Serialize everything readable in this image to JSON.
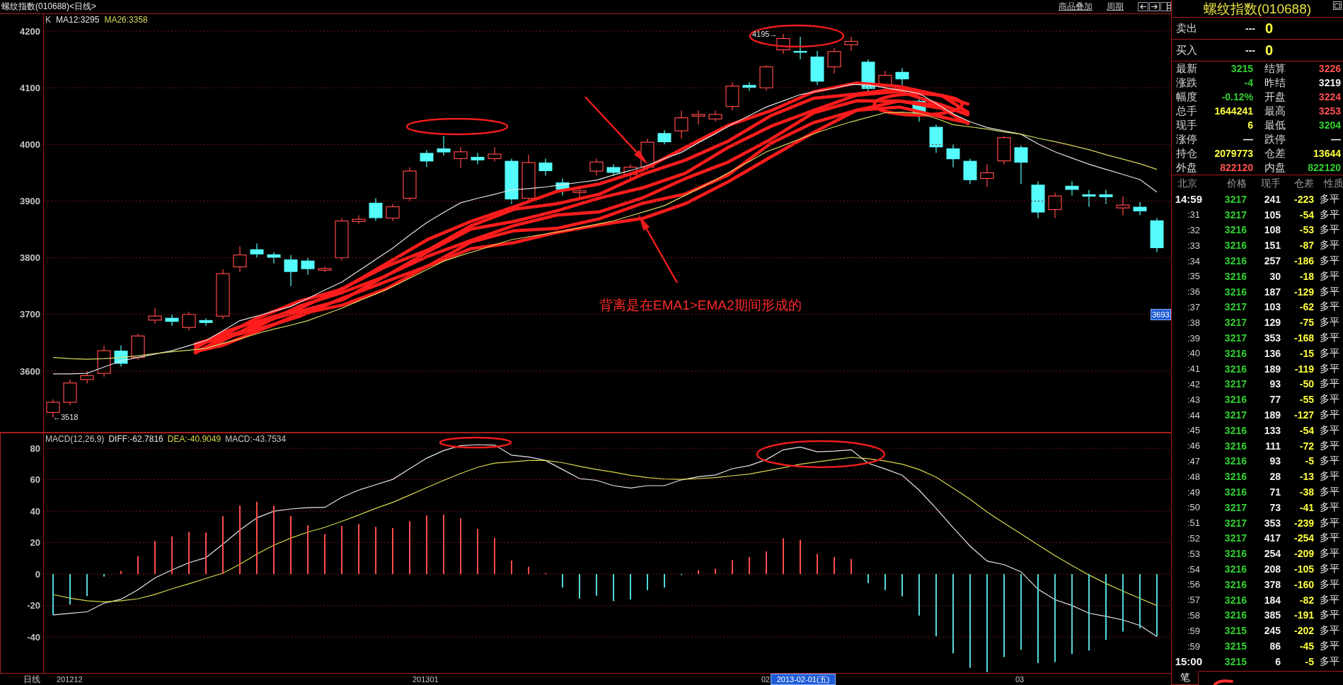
{
  "window": {
    "title": "螺纹指数(010688)<日线>"
  },
  "toolbar": {
    "links": [
      "商品叠加",
      "周期"
    ]
  },
  "price_panel": {
    "chart_data": {
      "type": "line",
      "title": "K",
      "ylim": [
        3492,
        4230
      ],
      "yticks": [
        4200,
        4100,
        4000,
        3900,
        3800,
        3700,
        3600
      ],
      "grid": true,
      "series": [
        {
          "name": "MA12:3295",
          "color": "#e2e2e2",
          "values": [
            3595,
            3595,
            3596,
            3607,
            3618,
            3624,
            3630,
            3636,
            3645,
            3654,
            3671,
            3689,
            3697,
            3706,
            3714,
            3728,
            3743,
            3757,
            3777,
            3797,
            3817,
            3840,
            3862,
            3880,
            3897,
            3905,
            3912,
            3920,
            3922,
            3925,
            3929,
            3933,
            3937,
            3946,
            3954,
            3963,
            3975,
            3986,
            4003,
            4019,
            4036,
            4051,
            4066,
            4077,
            4088,
            4094,
            4099,
            4106,
            4105,
            4100,
            4095,
            4090,
            4072,
            4054,
            4040,
            4030,
            4024,
            4018,
            4001,
            3987,
            3976,
            3965,
            3956,
            3947,
            3938,
            3916
          ]
        },
        {
          "name": "MA26:3358",
          "color": "#d8d860",
          "values": [
            3624,
            3622,
            3621,
            3622,
            3624,
            3627,
            3631,
            3634,
            3637,
            3640,
            3649,
            3657,
            3666,
            3674,
            3681,
            3689,
            3700,
            3711,
            3724,
            3736,
            3749,
            3764,
            3779,
            3794,
            3804,
            3813,
            3823,
            3832,
            3837,
            3842,
            3847,
            3853,
            3859,
            3865,
            3874,
            3883,
            3892,
            3907,
            3922,
            3937,
            3954,
            3970,
            3987,
            3998,
            4010,
            4021,
            4031,
            4040,
            4048,
            4056,
            4057,
            4055,
            4046,
            4035,
            4031,
            4027,
            4022,
            4018,
            4011,
            4005,
            3998,
            3991,
            3982,
            3974,
            3966,
            3956
          ]
        }
      ]
    },
    "high_label": "4195→",
    "low_label": "←3518",
    "price_tag": "3693",
    "annotation": "背离是在EMA1>EMA2期间形成的"
  },
  "macd_panel": {
    "chart_data": {
      "type": "bar",
      "title": "MACD(12,26,9)",
      "ylim": [
        -62.9,
        89.7
      ],
      "yticks": [
        80,
        60,
        40,
        20,
        0,
        -20,
        -40
      ],
      "grid": true,
      "series": [
        {
          "name": "DIFF:-62.7816",
          "type": "line",
          "color": "#e6e6e6",
          "values": [
            -26,
            -25,
            -24,
            -18.5,
            -16,
            -10,
            -2.4,
            2.6,
            7.2,
            10.4,
            19,
            28,
            35.7,
            40,
            41.4,
            42.2,
            42.4,
            48.8,
            53.4,
            56.8,
            60.2,
            67,
            73.7,
            78.5,
            81.7,
            82.3,
            82,
            75.6,
            74.5,
            72.2,
            66.5,
            60.7,
            59.6,
            56.2,
            54.7,
            56.2,
            56.2,
            59.9,
            61.9,
            63,
            67,
            69,
            72.8,
            79,
            80.8,
            77.7,
            78.2,
            79,
            70.5,
            66.8,
            62.8,
            53.3,
            41.8,
            29.5,
            17.8,
            8.3,
            6,
            1.4,
            -9.7,
            -16.3,
            -20,
            -24.9,
            -26.9,
            -29.2,
            -32.7,
            -39.8
          ]
        },
        {
          "name": "DEA:-40.9049",
          "type": "line",
          "color": "#d8d84c",
          "values": [
            -13,
            -15.3,
            -17,
            -17.7,
            -17,
            -15.7,
            -12.9,
            -9.4,
            -6.2,
            -2.8,
            0.6,
            6.2,
            12.7,
            18.3,
            22.9,
            26.7,
            29.7,
            33.5,
            37.5,
            41.8,
            45.6,
            50.2,
            55,
            59.6,
            64,
            67.9,
            70.5,
            71.3,
            72.2,
            72.2,
            70.8,
            68.5,
            66.5,
            64.8,
            62.8,
            61.3,
            60.5,
            60.2,
            60.7,
            61.3,
            62.5,
            63.6,
            65.6,
            67.6,
            69.9,
            71.3,
            72.8,
            74.2,
            73.4,
            71.9,
            69.9,
            66.5,
            61.6,
            54.7,
            47.6,
            39.5,
            32.4,
            25.5,
            18.6,
            11.7,
            5.4,
            -0.6,
            -6,
            -10.9,
            -15.5,
            -20
          ]
        },
        {
          "name": "MACD:-43.7534",
          "values": [
            -26,
            -19.4,
            -14,
            -1.6,
            2,
            11.4,
            21,
            24,
            26.8,
            26.4,
            36.8,
            43.6,
            46,
            43.4,
            37,
            31,
            25.4,
            30.6,
            31.8,
            30,
            29.2,
            33.6,
            37.4,
            37.8,
            35.4,
            28.8,
            23,
            8.6,
            4.6,
            0.4,
            -8.6,
            -15.6,
            -13.8,
            -17.2,
            -16.2,
            -10.2,
            -8.6,
            -0.6,
            2.4,
            3.4,
            9,
            10.8,
            14.4,
            22.8,
            21.8,
            12.8,
            10.8,
            9.6,
            -5.8,
            -10.2,
            -14.2,
            -26.4,
            -39.6,
            -50.4,
            -59.6,
            -62.4,
            -52.8,
            -48.2,
            -56.6,
            -56,
            -50.8,
            -48.6,
            -41.8,
            -36.6,
            -34.4,
            -39.6
          ],
          "colors": [
            "#54d8d8",
            "#54d8d8",
            "#54d8d8",
            "#54d8d8",
            "#ff4c4c",
            "#ff4c4c",
            "#ff4c4c",
            "#ff4c4c",
            "#ff4c4c",
            "#ff4c4c",
            "#ff4c4c",
            "#ff4c4c",
            "#ff4c4c",
            "#ff4c4c",
            "#ff4c4c",
            "#ff4c4c",
            "#ff4c4c",
            "#ff4c4c",
            "#ff4c4c",
            "#ff4c4c",
            "#ff4c4c",
            "#ff4c4c",
            "#ff4c4c",
            "#ff4c4c",
            "#ff4c4c",
            "#ff4c4c",
            "#ff4c4c",
            "#ff4c4c",
            "#ff4c4c",
            "#ff4c4c",
            "#54d8d8",
            "#54d8d8",
            "#54d8d8",
            "#54d8d8",
            "#54d8d8",
            "#54d8d8",
            "#54d8d8",
            "#54d8d8",
            "#ff4c4c",
            "#ff4c4c",
            "#ff4c4c",
            "#ff4c4c",
            "#ff4c4c",
            "#ff4c4c",
            "#ff4c4c",
            "#ff4c4c",
            "#ff4c4c",
            "#ff4c4c",
            "#54d8d8",
            "#54d8d8",
            "#54d8d8",
            "#54d8d8",
            "#54d8d8",
            "#54d8d8",
            "#54d8d8",
            "#54d8d8",
            "#54d8d8",
            "#54d8d8",
            "#54d8d8",
            "#54d8d8",
            "#54d8d8",
            "#54d8d8",
            "#54d8d8",
            "#54d8d8",
            "#54d8d8",
            "#54d8d8"
          ]
        }
      ]
    }
  },
  "date_axis": {
    "period": "日线",
    "ticks": [
      "201212",
      "201301",
      "02",
      "03"
    ],
    "cursor_date": "2013-02-01(五)"
  },
  "quote_panel": {
    "title": "螺纹指数(010688)",
    "orders": [
      {
        "label": "卖出",
        "price": "---",
        "volume": "0"
      },
      {
        "label": "买入",
        "price": "---",
        "volume": "0"
      }
    ],
    "stats": [
      {
        "label": "最新",
        "value": "3215",
        "color": "#30d030"
      },
      {
        "label": "结算",
        "value": "3226",
        "color": "#ff5050"
      },
      {
        "label": "涨跌",
        "value": "-4",
        "color": "#30d030"
      },
      {
        "label": "昨结",
        "value": "3219",
        "color": "#f0f0f0"
      },
      {
        "label": "幅度",
        "value": "-0.12%",
        "color": "#30d030"
      },
      {
        "label": "开盘",
        "value": "3224",
        "color": "#ff5050"
      },
      {
        "label": "总手",
        "value": "1644241",
        "color": "#ffff40"
      },
      {
        "label": "最高",
        "value": "3253",
        "color": "#ff5050"
      },
      {
        "label": "现手",
        "value": "6",
        "color": "#ffff40"
      },
      {
        "label": "最低",
        "value": "3204",
        "color": "#30d030"
      },
      {
        "label": "涨停",
        "value": "—",
        "color": "#f0f0f0"
      },
      {
        "label": "跌停",
        "value": "—",
        "color": "#f0f0f0"
      },
      {
        "label": "持仓",
        "value": "2079773",
        "color": "#ffff40"
      },
      {
        "label": "仓差",
        "value": "13644",
        "color": "#ffff40"
      },
      {
        "label": "外盘",
        "value": "822120",
        "color": "#ff5050"
      },
      {
        "label": "内盘",
        "value": "822120",
        "color": "#30d030"
      }
    ],
    "tick_columns": [
      "北京",
      "价格",
      "现手",
      "仓差",
      "性质"
    ],
    "ticks": [
      {
        "kind": "full",
        "time": "14:59",
        "price": "3217",
        "volume": "241",
        "change": "-223",
        "nature": "多平"
      },
      {
        "kind": "short",
        "time": ":31",
        "price": "3217",
        "volume": "105",
        "change": "-54",
        "nature": "多平"
      },
      {
        "kind": "short",
        "time": ":32",
        "price": "3216",
        "volume": "108",
        "change": "-53",
        "nature": "多平"
      },
      {
        "kind": "short",
        "time": ":33",
        "price": "3216",
        "volume": "151",
        "change": "-87",
        "nature": "多平"
      },
      {
        "kind": "short",
        "time": ":34",
        "price": "3216",
        "volume": "257",
        "change": "-186",
        "nature": "多平"
      },
      {
        "kind": "short",
        "time": ":35",
        "price": "3216",
        "volume": "30",
        "change": "-18",
        "nature": "多平"
      },
      {
        "kind": "short",
        "time": ":36",
        "price": "3216",
        "volume": "187",
        "change": "-129",
        "nature": "多平"
      },
      {
        "kind": "short",
        "time": ":37",
        "price": "3217",
        "volume": "103",
        "change": "-62",
        "nature": "多平"
      },
      {
        "kind": "short",
        "time": ":38",
        "price": "3217",
        "volume": "129",
        "change": "-75",
        "nature": "多平"
      },
      {
        "kind": "short",
        "time": ":39",
        "price": "3217",
        "volume": "353",
        "change": "-168",
        "nature": "多平"
      },
      {
        "kind": "short",
        "time": ":40",
        "price": "3216",
        "volume": "136",
        "change": "-15",
        "nature": "多平"
      },
      {
        "kind": "short",
        "time": ":41",
        "price": "3216",
        "volume": "189",
        "change": "-119",
        "nature": "多平"
      },
      {
        "kind": "short",
        "time": ":42",
        "price": "3217",
        "volume": "93",
        "change": "-50",
        "nature": "多平"
      },
      {
        "kind": "short",
        "time": ":43",
        "price": "3216",
        "volume": "77",
        "change": "-55",
        "nature": "多平"
      },
      {
        "kind": "short",
        "time": ":44",
        "price": "3217",
        "volume": "189",
        "change": "-127",
        "nature": "多平"
      },
      {
        "kind": "short",
        "time": ":45",
        "price": "3216",
        "volume": "133",
        "change": "-54",
        "nature": "多平"
      },
      {
        "kind": "short",
        "time": ":46",
        "price": "3216",
        "volume": "111",
        "change": "-72",
        "nature": "多平"
      },
      {
        "kind": "short",
        "time": ":47",
        "price": "3216",
        "volume": "93",
        "change": "-5",
        "nature": "多平"
      },
      {
        "kind": "short",
        "time": ":48",
        "price": "3216",
        "volume": "28",
        "change": "-13",
        "nature": "多平"
      },
      {
        "kind": "short",
        "time": ":49",
        "price": "3216",
        "volume": "71",
        "change": "-38",
        "nature": "多平"
      },
      {
        "kind": "short",
        "time": ":50",
        "price": "3217",
        "volume": "73",
        "change": "-41",
        "nature": "多平"
      },
      {
        "kind": "short",
        "time": ":51",
        "price": "3217",
        "volume": "353",
        "change": "-239",
        "nature": "多平"
      },
      {
        "kind": "short",
        "time": ":52",
        "price": "3217",
        "volume": "417",
        "change": "-254",
        "nature": "多平"
      },
      {
        "kind": "short",
        "time": ":53",
        "price": "3216",
        "volume": "254",
        "change": "-209",
        "nature": "多平"
      },
      {
        "kind": "short",
        "time": ":54",
        "price": "3216",
        "volume": "208",
        "change": "-105",
        "nature": "多平"
      },
      {
        "kind": "short",
        "time": ":56",
        "price": "3216",
        "volume": "378",
        "change": "-160",
        "nature": "多平"
      },
      {
        "kind": "short",
        "time": ":57",
        "price": "3216",
        "volume": "184",
        "change": "-82",
        "nature": "多平"
      },
      {
        "kind": "short",
        "time": ":58",
        "price": "3216",
        "volume": "385",
        "change": "-191",
        "nature": "多平"
      },
      {
        "kind": "short",
        "time": ":59",
        "price": "3215",
        "volume": "245",
        "change": "-202",
        "nature": "多平"
      },
      {
        "kind": "short",
        "time": ":59",
        "price": "3215",
        "volume": "86",
        "change": "-45",
        "nature": "多平"
      },
      {
        "kind": "full",
        "time": "15:00",
        "price": "3215",
        "volume": "6",
        "change": "-5",
        "nature": "多平"
      }
    ],
    "tabs": [
      {
        "label": "笔",
        "selected": true
      }
    ]
  }
}
